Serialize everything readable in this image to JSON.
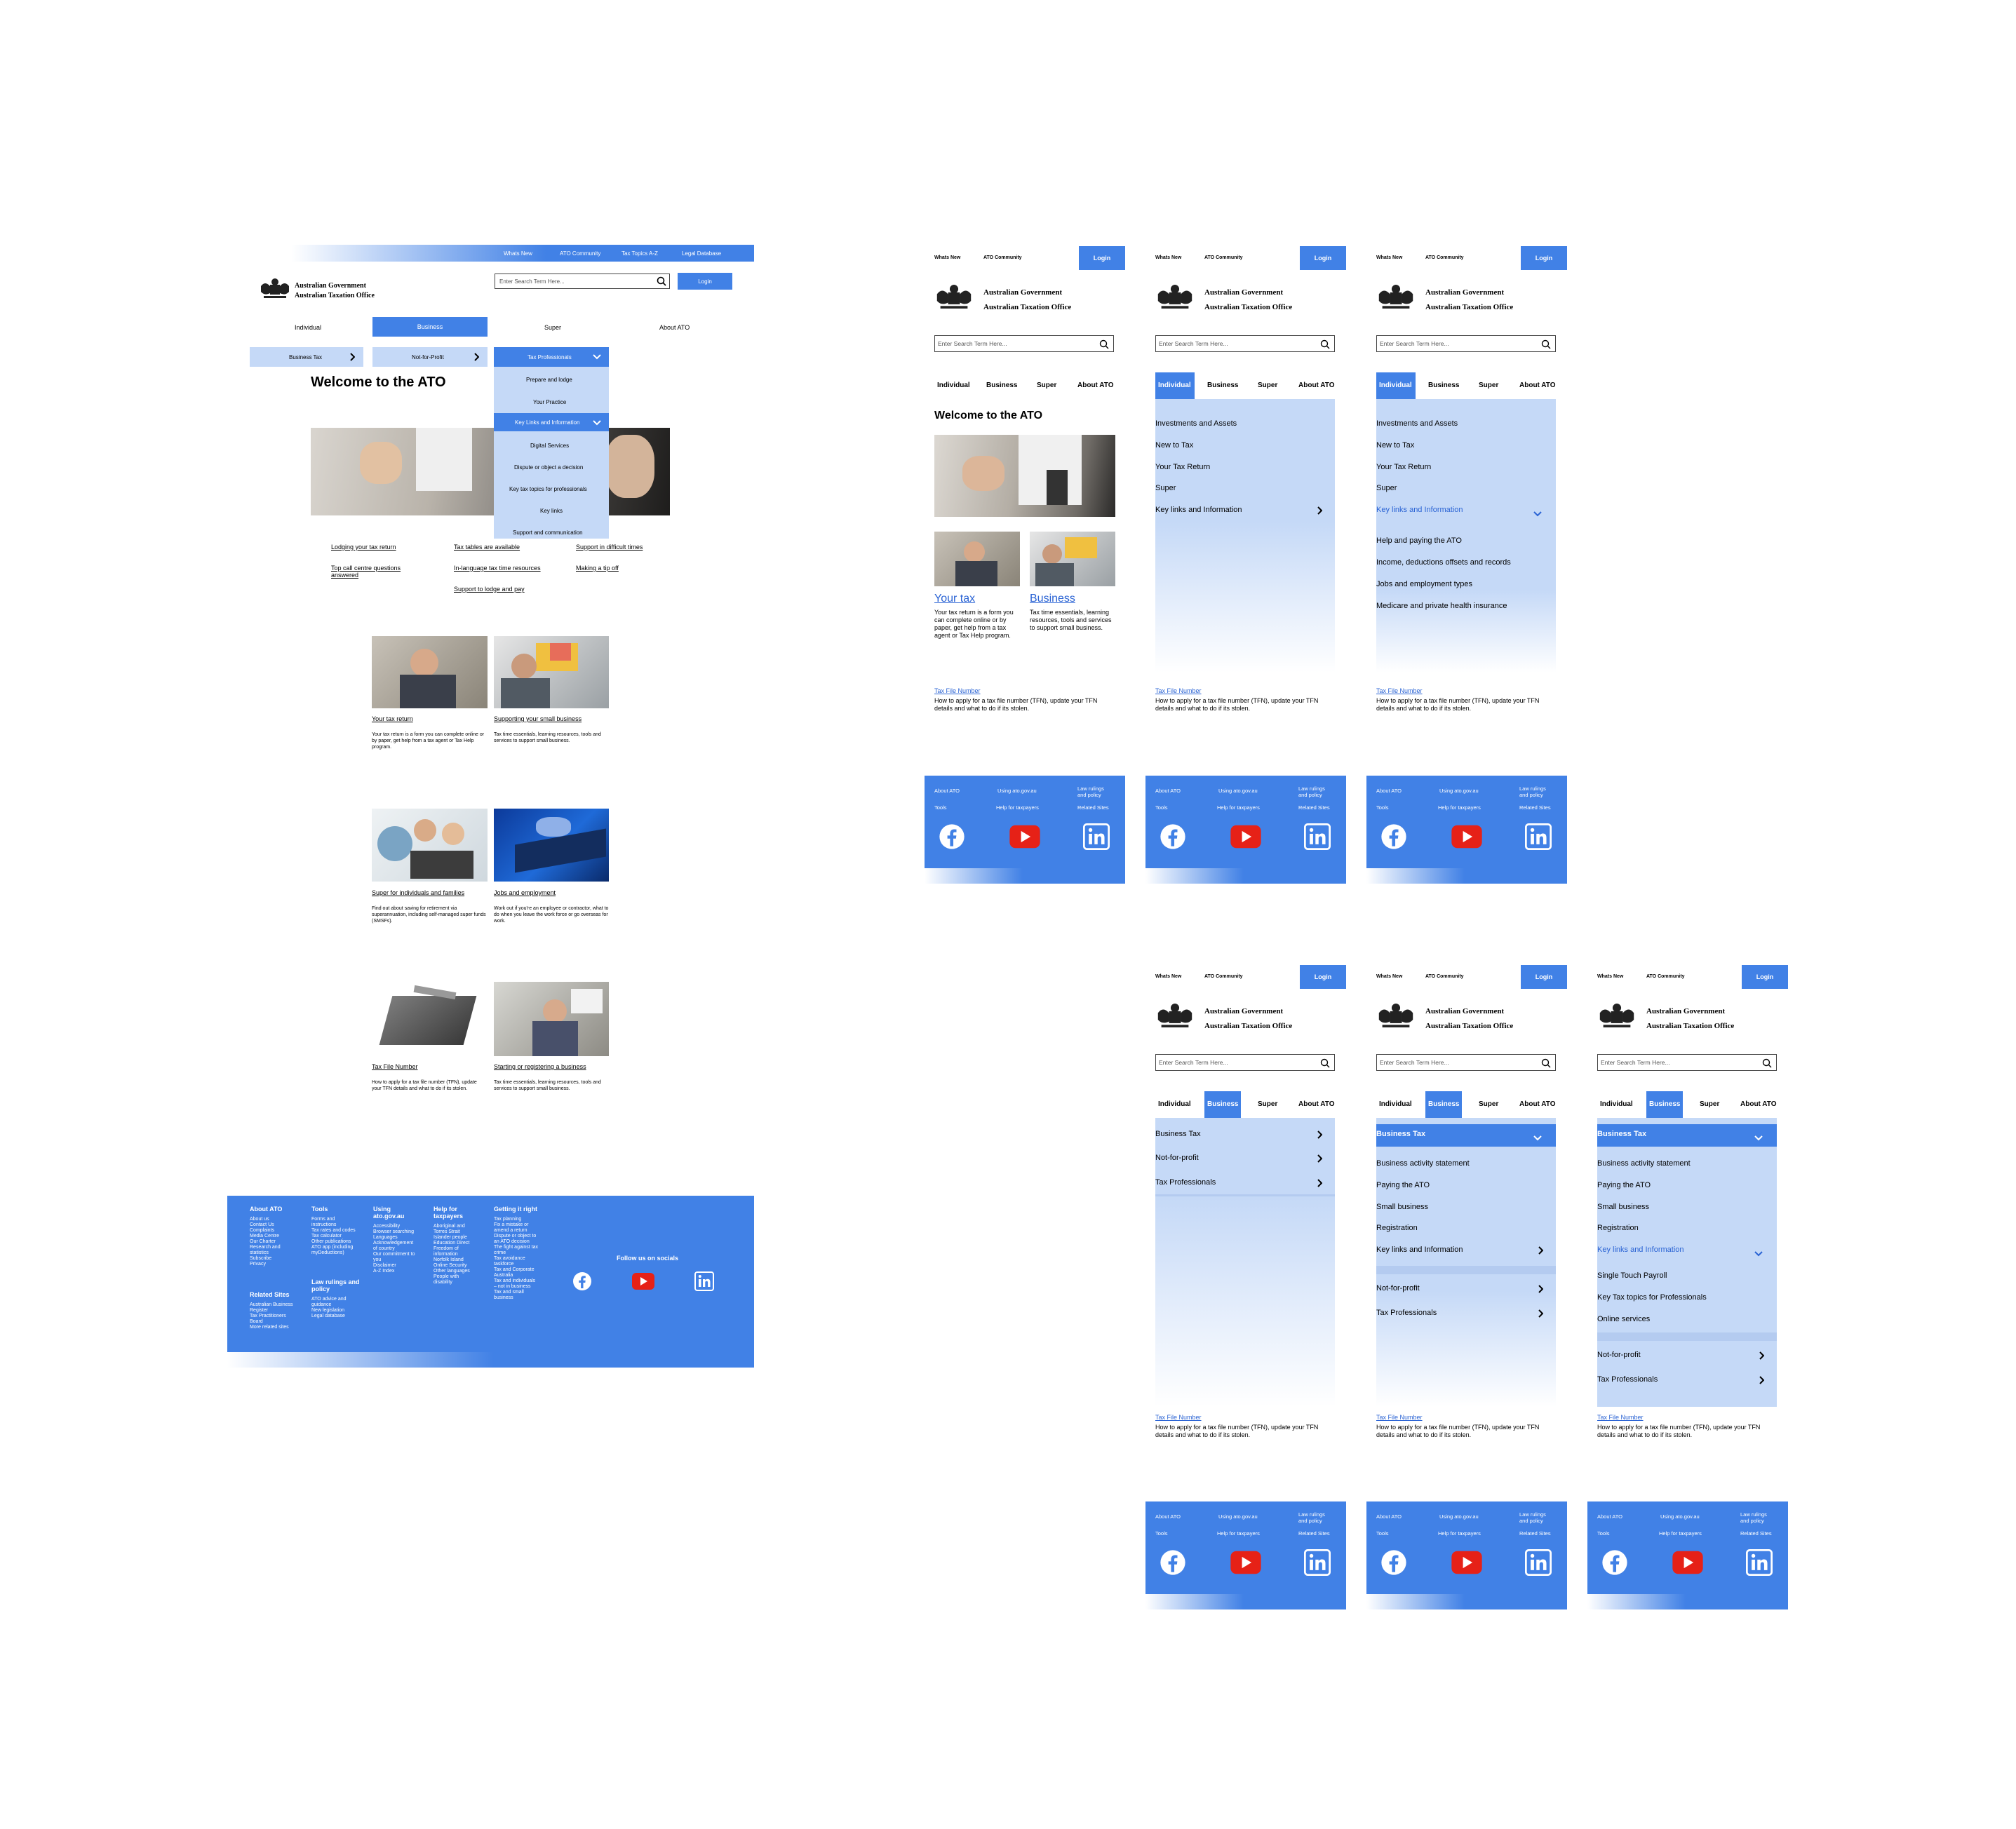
{
  "desktop": {
    "utility_nav": [
      "Whats New",
      "ATO Community",
      "Tax Topics A-Z",
      "Legal Database"
    ],
    "search_placeholder": "Enter Search Term Here...",
    "login_label": "Login",
    "gov_line1": "Australian Government",
    "gov_line2": "Australian Taxation Office",
    "main_nav": [
      "Individual",
      "Business",
      "Super",
      "About ATO"
    ],
    "sub_nav": [
      "Business Tax",
      "Not-for-Profit",
      "Tax Professionals"
    ],
    "dropdown": [
      "Prepare and lodge",
      "Your Practice",
      "Key Links and Information",
      "Digital Services",
      "Dispute or object a decision",
      "Key tax topics for professionals",
      "Key links",
      "Support and communication"
    ],
    "welcome": "Welcome to the ATO",
    "quick_links": [
      "Lodging your tax return",
      "Tax tables are available",
      "Support in difficult times",
      "Top call centre questions answered",
      "In-language tax time resources",
      "Making a tip off",
      "Support to lodge and pay"
    ],
    "cards": [
      {
        "title": "Your tax return",
        "desc": "Your tax return is a form you can complete online or by paper, get help from a tax agent or Tax Help program."
      },
      {
        "title": "Supporting your small business",
        "desc": "Tax time essentials, learning resources, tools and services to support small business."
      },
      {
        "title": "Super for individuals and families",
        "desc": "Find out about saving for retirement via superannuation, including self-managed super funds (SMSFs)."
      },
      {
        "title": "Jobs and employment",
        "desc": "Work out if you're an employee or contractor, what to do when you leave the work force or go overseas for work."
      },
      {
        "title": "Tax File Number",
        "desc": "How to apply for a tax file number (TFN), update your TFN details and what to do if its stolen."
      },
      {
        "title": "Starting or registering a business",
        "desc": "Tax time essentials, learning resources, tools and services to support small business."
      }
    ],
    "footer": {
      "about_title": "About ATO",
      "about_items": [
        "About us",
        "Contact Us",
        "Complaints",
        "Media Centre",
        "Our Charter",
        "Research and statistics",
        "Subscribe",
        "Privacy"
      ],
      "related_title": "Related Sites",
      "related_items": [
        "Australian Business Register",
        "Tax Practitioners Board",
        "More related sites"
      ],
      "tools_title": "Tools",
      "tools_items": [
        "Forms and instructions",
        "Tax rates and codes",
        "Tax calculator",
        "Other publications",
        "ATO app (including myDeductions)"
      ],
      "law_title": "Law rulings and policy",
      "law_items": [
        "ATO advice and guidance",
        "New legislation",
        "Legal database"
      ],
      "using_title": "Using ato.gov.au",
      "using_items": [
        "Accessibility",
        "Browser searching",
        "Languages",
        "Acknowledgement of country",
        "Our commitment to you",
        "Disclaimer",
        "A-Z Index"
      ],
      "help_title": "Help for taxpayers",
      "help_items": [
        "Aboriginal and Torres Strait Islander people",
        "Education Direct",
        "Freedom of information",
        "Norfolk Island",
        "Online Security",
        "Other languages",
        "People with disability"
      ],
      "right_title": "Getting it right",
      "right_items": [
        "Tax planning",
        "Fix a mistake or amend a return",
        "Dispute or object to an ATO decision",
        "The fight against tax crime",
        "Tax avoidance taskforce",
        "Tax and Corporate Australia",
        "Tax and individuals – not in business",
        "Tax and small business"
      ],
      "social_title": "Follow us on socials"
    }
  },
  "mobile": {
    "top_links": [
      "Whats New",
      "ATO Community"
    ],
    "login_label": "Login",
    "gov_line1": "Australian Government",
    "gov_line2": "Australian Taxation Office",
    "search_placeholder": "Enter Search Term Here...",
    "nav": [
      "Individual",
      "Business",
      "Super",
      "About ATO"
    ],
    "welcome": "Welcome to the ATO",
    "card1_title": "Your tax",
    "card1_desc": "Your tax return is a form you can complete online or by paper, get help from a tax agent or Tax Help program.",
    "card2_title": "Business",
    "card2_desc": "Tax time essentials, learning resources, tools and services to support small business.",
    "tfn_title": "Tax File Number",
    "tfn_desc": "How to apply for a tax file number (TFN), update your TFN details and what to do if its stolen.",
    "individual_menu": [
      "Investments and Assets",
      "New to Tax",
      "Your Tax Return",
      "Super",
      "Key links and Information"
    ],
    "key_links_sub": [
      "Help and paying the ATO",
      "Income, deductions offsets and records",
      "Jobs and employment types",
      "Medicare and private health insurance"
    ],
    "business_menu": [
      "Business Tax",
      "Not-for-profit",
      "Tax Professionals"
    ],
    "business_tax_sub": [
      "Business activity statement",
      "Paying the ATO",
      "Small business",
      "Registration",
      "Key links and Information"
    ],
    "business_key_sub": [
      "Single Touch Payroll",
      "Key Tax topics for Professionals",
      "Online services"
    ],
    "footer": {
      "about": "About ATO",
      "tools": "Tools",
      "using": "Using ato.gov.au",
      "help": "Help for taxpayers",
      "law": "Law rulings and policy",
      "related": "Related Sites"
    }
  }
}
